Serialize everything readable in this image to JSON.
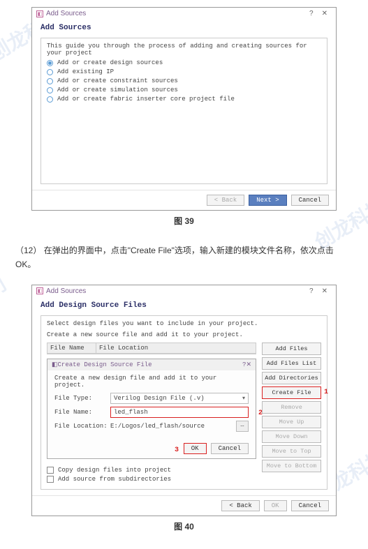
{
  "watermarks": [
    "创龙科技",
    "创龙科技",
    "创龙科技",
    "刂"
  ],
  "fig39": {
    "window_title": "Add Sources",
    "help": "?",
    "close": "✕",
    "heading": "Add Sources",
    "guide": "This guide you through the process of adding and creating sources for your project",
    "options": [
      "Add or create design sources",
      "Add existing IP",
      "Add or create constraint sources",
      "Add or create simulation sources",
      "Add or create fabric inserter core project file"
    ],
    "btn_back": "< Back",
    "btn_next": "Next >",
    "btn_cancel": "Cancel",
    "caption": "图 39"
  },
  "step12": {
    "num": "（12）",
    "text": "在弹出的界面中，点击\"Create File\"选项，输入新建的模块文件名称，依次点击 OK。"
  },
  "fig40": {
    "window_title": "Add Sources",
    "help": "?",
    "close": "✕",
    "heading": "Add Design Source Files",
    "desc1": "Select design files you want to include in your project.",
    "desc2": "Create a new source file and add it to your project.",
    "col_name": "File Name",
    "col_loc": "File Location",
    "side": {
      "add_files": "Add Files",
      "add_list": "Add Files List",
      "add_dirs": "Add Directories",
      "create": "Create File",
      "remove": "Remove",
      "move_up": "Move Up",
      "move_down": "Move Down",
      "move_top": "Move to Top",
      "move_bottom": "Move to Bottom"
    },
    "inner": {
      "title": "Create Design Source File",
      "help": "?",
      "close": "✕",
      "desc": "Create a new design file and add it to your project.",
      "lbl_type": "File Type:",
      "val_type": "Verilog Design File (.v)",
      "lbl_name": "File Name:",
      "val_name": "led_flash",
      "lbl_loc": "File Location:",
      "val_loc": "E:/Logos/led_flash/source",
      "btn_ok": "OK",
      "btn_cancel": "Cancel"
    },
    "check1": "Copy design files into project",
    "check2": "Add source from subdirectories",
    "btn_back": "< Back",
    "btn_ok": "OK",
    "btn_cancel": "Cancel",
    "caption": "图 40",
    "marks": {
      "m1": "1",
      "m2": "2",
      "m3": "3"
    }
  }
}
